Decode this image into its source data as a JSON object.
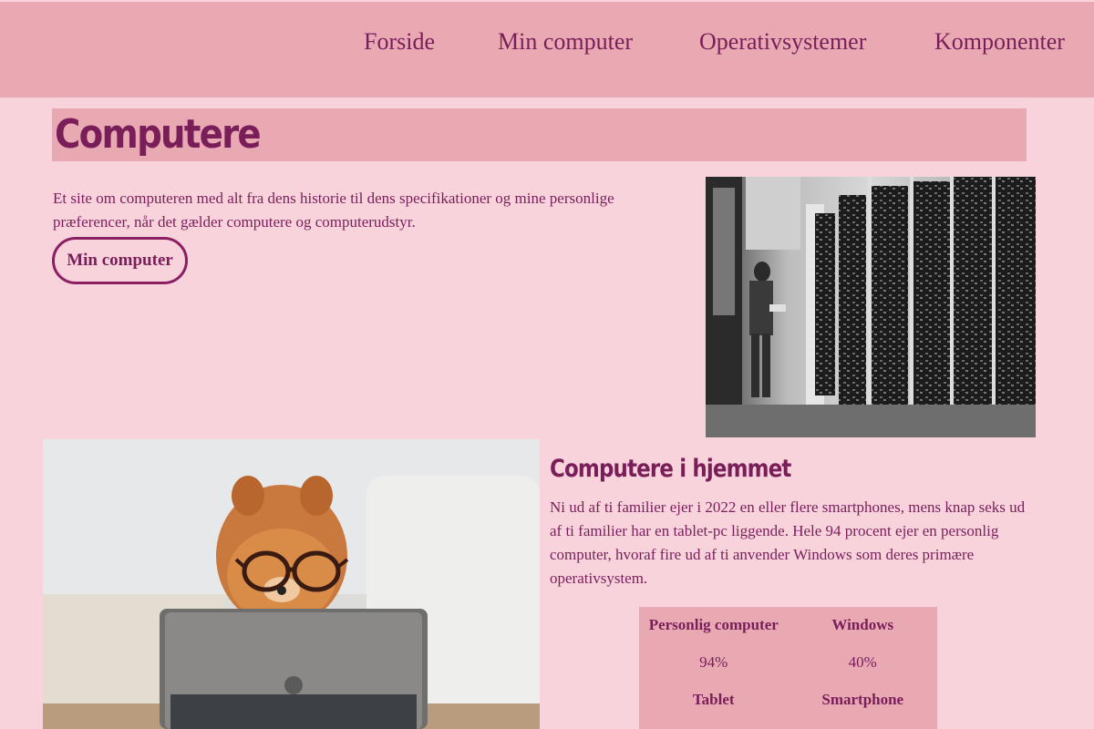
{
  "nav": {
    "items": [
      {
        "label": "Forside"
      },
      {
        "label": "Min computer"
      },
      {
        "label": "Operativsystemer"
      },
      {
        "label": "Komponenter"
      }
    ]
  },
  "hero": {
    "title": "Computere",
    "intro": "Et site om computeren med alt fra dens historie til dens specifikationer og mine personlige præferencer, når det gælder computere og computerudstyr.",
    "button_label": "Min computer"
  },
  "section": {
    "title": "Computere i hjemmet",
    "text": "Ni ud af ti familier ejer i 2022 en eller flere smartphones, mens knap seks ud af ti familier har en tablet-pc liggende. Hele 94 procent ejer en personlig computer, hvoraf fire ud af ti anvender Windows som deres primære operativsystem."
  },
  "stats": {
    "rows": [
      {
        "a": "Personlig computer",
        "b": "Windows",
        "header": true
      },
      {
        "a": "94%",
        "b": "40%",
        "header": false
      },
      {
        "a": "Tablet",
        "b": "Smartphone",
        "header": true
      }
    ]
  },
  "images": {
    "servers": "server-room-photo",
    "dog": "dog-with-glasses-tablet-photo"
  },
  "colors": {
    "background": "#f8d3dc",
    "bar": "#e9a9b3",
    "text": "#7a1e5a"
  }
}
